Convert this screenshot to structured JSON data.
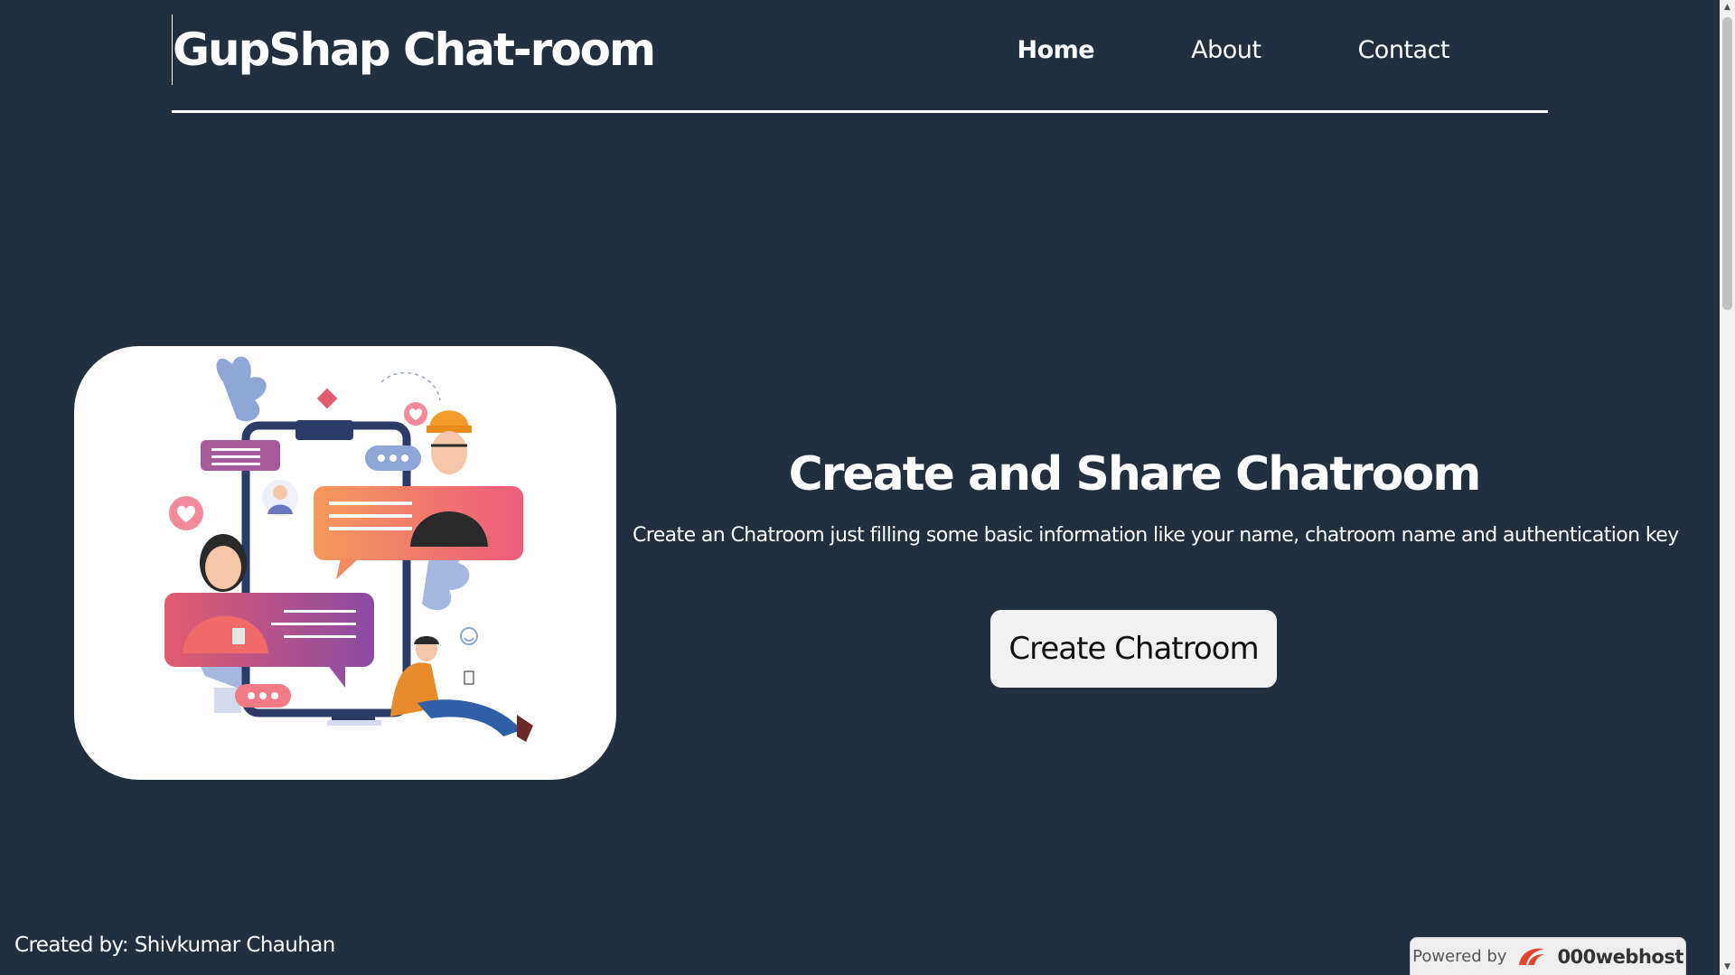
{
  "header": {
    "brand": "GupShap Chat-room",
    "nav": [
      "Home",
      "About",
      "Contact"
    ],
    "active_nav": "Home"
  },
  "hero": {
    "illustration": "people-chatting-around-smartphone-illustration",
    "title": "Create and Share Chatroom",
    "description": "Create an Chatroom just filling some basic information like your name, chatroom name and authentication key",
    "button_label": "Create Chatroom"
  },
  "footer": {
    "credit": "Created by: Shivkumar Chauhan",
    "powered_label": "Powered by",
    "powered_brand": "000webhost"
  },
  "colors": {
    "background": "#222f3e",
    "text": "#ffffff",
    "button_bg": "#f1f1f1",
    "accent_pink": "#e25c6e",
    "accent_orange": "#f28a5b",
    "accent_purple": "#8a4ba3"
  }
}
